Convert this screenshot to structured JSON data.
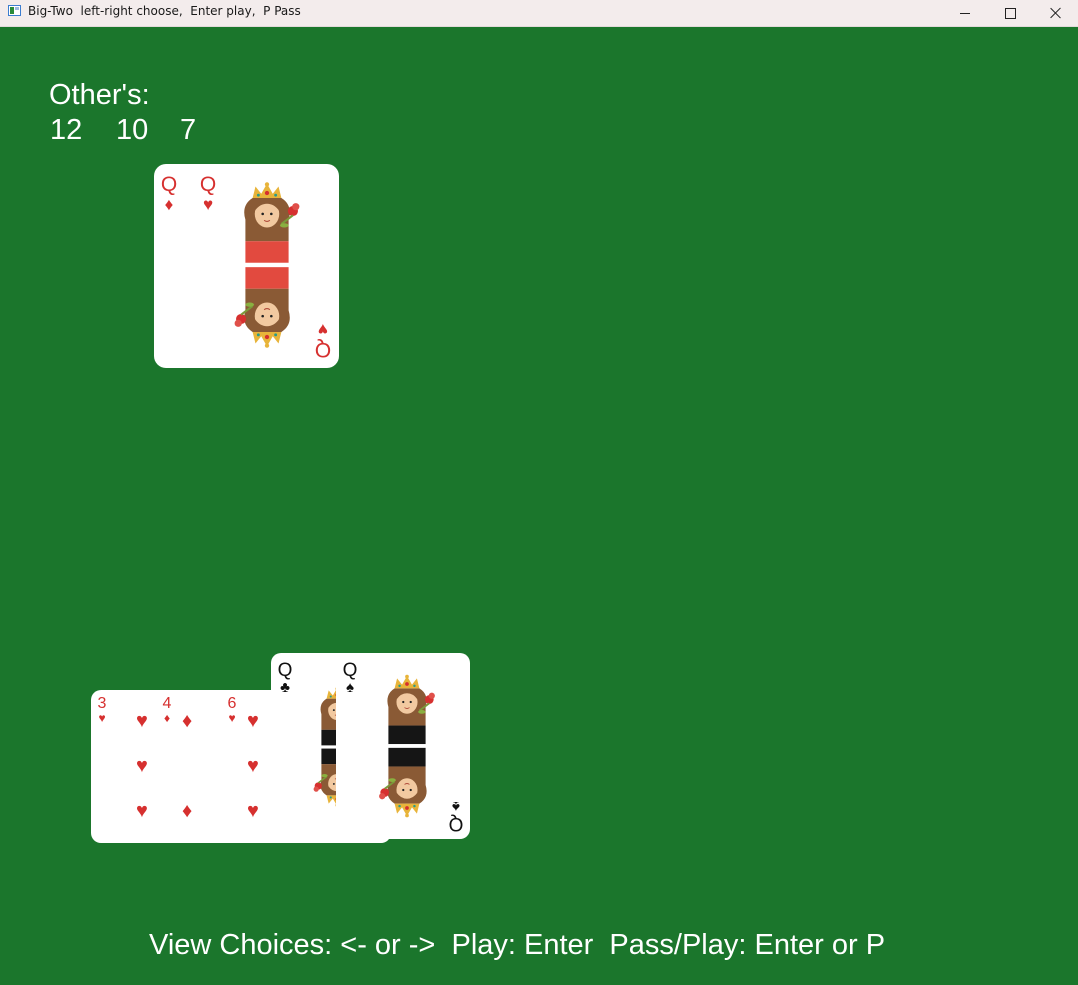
{
  "window": {
    "title": "Big-Two  left-right choose,  Enter play,  P Pass",
    "app_icon": "app-window-icon",
    "controls": [
      "minimize-icon",
      "maximize-icon",
      "close-icon"
    ]
  },
  "others": {
    "label": "Other's:",
    "counts": [
      "12",
      "10",
      "7"
    ]
  },
  "table_cards": {
    "q_diamonds": {
      "rank": "Q",
      "suit": "♦",
      "color": "#d6302f"
    },
    "q_hearts": {
      "rank": "Q",
      "suit": "♥",
      "color": "#d6302f"
    }
  },
  "hand_cards": {
    "three_hearts": {
      "rank": "3",
      "suit": "♥"
    },
    "four_diamonds": {
      "rank": "4",
      "suit": "♦"
    },
    "six_hearts": {
      "rank": "6",
      "suit": "♥"
    },
    "q_clubs": {
      "rank": "Q",
      "suit": "♣"
    },
    "q_spades": {
      "rank": "Q",
      "suit": "♠"
    }
  },
  "instructions": "View Choices: <- or ->  Play: Enter  Pass/Play: Enter or P",
  "colors": {
    "table_felt": "#1b762c",
    "red_suit": "#d6302f",
    "black_suit": "#111111"
  }
}
